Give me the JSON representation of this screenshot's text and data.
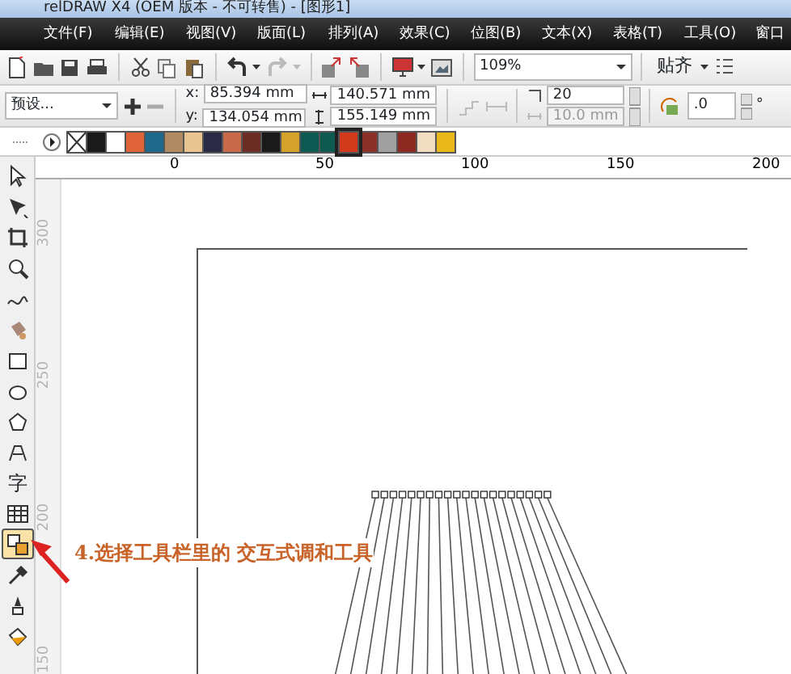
{
  "window": {
    "title": "relDRAW X4 (OEM 版本 - 不可转售) - [图形1]"
  },
  "menu": [
    "文件(F)",
    "编辑(E)",
    "视图(V)",
    "版面(L)",
    "排列(A)",
    "效果(C)",
    "位图(B)",
    "文本(X)",
    "表格(T)",
    "工具(O)",
    "窗口"
  ],
  "toolbar": {
    "zoom": "109%",
    "snap": "贴齐"
  },
  "property_bar": {
    "preset": "预设...",
    "x_label": "x:",
    "x": "85.394 mm",
    "y_label": "y:",
    "y": "134.054 mm",
    "width": "140.571 mm",
    "height": "155.149 mm",
    "steps": "20",
    "spacing": {
      "value": "10.0 mm",
      "disabled": true
    },
    "rotation": ".0",
    "rotation_unit": "°"
  },
  "palette": [
    {
      "kind": "none"
    },
    {
      "kind": "swatch",
      "color": "#1a1a1a",
      "selected": false
    },
    {
      "kind": "swatch",
      "color": "#ffffff",
      "selected": false
    },
    {
      "kind": "swatch",
      "color": "#e0643a",
      "selected": false
    },
    {
      "kind": "swatch",
      "color": "#1f6a8c",
      "selected": false
    },
    {
      "kind": "swatch",
      "color": "#b08a62",
      "selected": false
    },
    {
      "kind": "swatch",
      "color": "#e8c590",
      "selected": false
    },
    {
      "kind": "swatch",
      "color": "#2a2a45",
      "selected": false
    },
    {
      "kind": "swatch",
      "color": "#c86a4a",
      "selected": false
    },
    {
      "kind": "swatch",
      "color": "#6b2e25",
      "selected": false
    },
    {
      "kind": "swatch",
      "color": "#1a1a1a",
      "selected": false
    },
    {
      "kind": "swatch",
      "color": "#d4a22a",
      "selected": false
    },
    {
      "kind": "swatch",
      "color": "#0c5a52",
      "selected": false
    },
    {
      "kind": "swatch",
      "color": "#0f5a50",
      "selected": false
    },
    {
      "kind": "swatch",
      "color": "#d13a1a",
      "selected": true
    },
    {
      "kind": "swatch",
      "color": "#8a3028",
      "selected": false
    },
    {
      "kind": "swatch",
      "color": "#a0a0a0",
      "selected": false
    },
    {
      "kind": "swatch",
      "color": "#8c2a22",
      "selected": false
    },
    {
      "kind": "swatch",
      "color": "#f0dcc0",
      "selected": false
    },
    {
      "kind": "swatch",
      "color": "#e8b81a",
      "selected": false
    }
  ],
  "rulers": {
    "horizontal": [
      "0",
      "50",
      "100",
      "150",
      "200"
    ],
    "vertical": [
      "300",
      "250",
      "200",
      "150"
    ]
  },
  "tools": [
    {
      "kind": "pick",
      "selected": false
    },
    {
      "kind": "shape",
      "selected": false
    },
    {
      "kind": "crop",
      "selected": false
    },
    {
      "kind": "zoom",
      "selected": false
    },
    {
      "kind": "freehand",
      "selected": false
    },
    {
      "kind": "smart-fill",
      "selected": false
    },
    {
      "kind": "rectangle",
      "selected": false
    },
    {
      "kind": "ellipse",
      "selected": false
    },
    {
      "kind": "polygon",
      "selected": false
    },
    {
      "kind": "basic-shapes",
      "selected": false
    },
    {
      "kind": "text",
      "label": "字",
      "selected": false
    },
    {
      "kind": "table",
      "selected": false
    },
    {
      "kind": "blend",
      "selected": true
    },
    {
      "kind": "eyedropper",
      "selected": false
    },
    {
      "kind": "outline",
      "selected": false
    },
    {
      "kind": "fill",
      "selected": false
    }
  ],
  "annotation": {
    "text": "4.选择工具栏里的 交互式调和工具"
  }
}
